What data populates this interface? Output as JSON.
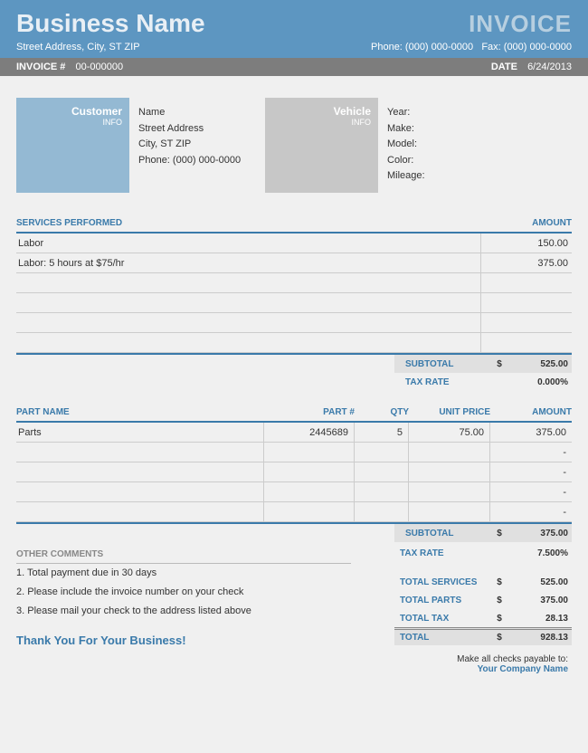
{
  "header": {
    "company_name": "Business Name",
    "invoice_title": "INVOICE",
    "address": "Street Address, City, ST ZIP",
    "phone": "Phone: (000) 000-0000",
    "fax": "Fax: (000) 000-0000",
    "invoice_num_label": "INVOICE #",
    "invoice_num": "00-000000",
    "date_label": "DATE",
    "date": "6/24/2013"
  },
  "customer_block": {
    "title": "Customer",
    "sub": "INFO",
    "name": "Name",
    "street": "Street Address",
    "city": "City, ST ZIP",
    "phone": "Phone: (000) 000-0000"
  },
  "vehicle_block": {
    "title": "Vehicle",
    "sub": "INFO",
    "year": "Year:",
    "make": "Make:",
    "model": "Model:",
    "color": "Color:",
    "mileage": "Mileage:"
  },
  "services": {
    "header_desc": "SERVICES PERFORMED",
    "header_amt": "AMOUNT",
    "rows": [
      {
        "desc": "Labor",
        "amt": "150.00"
      },
      {
        "desc": "Labor: 5 hours at $75/hr",
        "amt": "375.00"
      },
      {
        "desc": "",
        "amt": ""
      },
      {
        "desc": "",
        "amt": ""
      },
      {
        "desc": "",
        "amt": ""
      },
      {
        "desc": "",
        "amt": ""
      }
    ],
    "subtotal_label": "SUBTOTAL",
    "subtotal_cur": "$",
    "subtotal": "525.00",
    "taxrate_label": "TAX RATE",
    "taxrate": "0.000%"
  },
  "parts": {
    "h_name": "PART NAME",
    "h_num": "PART  #",
    "h_qty": "QTY",
    "h_price": "UNIT PRICE",
    "h_amt": "AMOUNT",
    "rows": [
      {
        "name": "Parts",
        "num": "2445689",
        "qty": "5",
        "price": "75.00",
        "amt": "375.00"
      },
      {
        "name": "",
        "num": "",
        "qty": "",
        "price": "",
        "amt": "-"
      },
      {
        "name": "",
        "num": "",
        "qty": "",
        "price": "",
        "amt": "-"
      },
      {
        "name": "",
        "num": "",
        "qty": "",
        "price": "",
        "amt": "-"
      },
      {
        "name": "",
        "num": "",
        "qty": "",
        "price": "",
        "amt": "-"
      }
    ],
    "subtotal_label": "SUBTOTAL",
    "subtotal_cur": "$",
    "subtotal": "375.00",
    "taxrate_label": "TAX RATE",
    "taxrate": "7.500%"
  },
  "comments": {
    "header": "OTHER COMMENTS",
    "lines": [
      "1. Total payment due in 30 days",
      "2. Please include the invoice number on your check",
      "3. Please mail your check to the address listed above"
    ],
    "thank_you": "Thank You For Your Business!"
  },
  "totals": {
    "total_services_label": "TOTAL SERVICES",
    "total_services": "525.00",
    "total_parts_label": "TOTAL PARTS",
    "total_parts": "375.00",
    "total_tax_label": "TOTAL TAX",
    "total_tax": "28.13",
    "total_label": "TOTAL",
    "total": "928.13",
    "currency": "$",
    "payable_text": "Make all checks payable to:",
    "payable_name": "Your Company Name"
  }
}
